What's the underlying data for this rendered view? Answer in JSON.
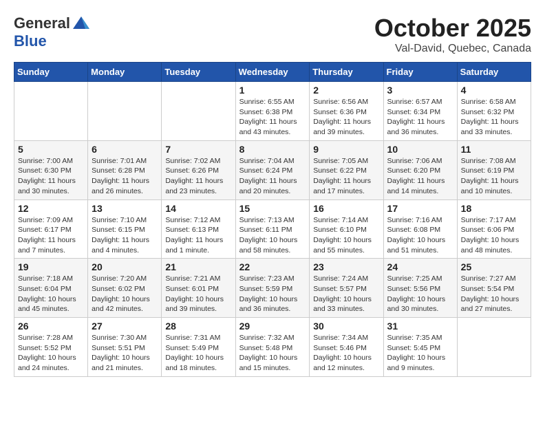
{
  "header": {
    "logo_line1": "General",
    "logo_line2": "Blue",
    "month": "October 2025",
    "location": "Val-David, Quebec, Canada"
  },
  "days_of_week": [
    "Sunday",
    "Monday",
    "Tuesday",
    "Wednesday",
    "Thursday",
    "Friday",
    "Saturday"
  ],
  "weeks": [
    [
      {
        "day": "",
        "info": ""
      },
      {
        "day": "",
        "info": ""
      },
      {
        "day": "",
        "info": ""
      },
      {
        "day": "1",
        "info": "Sunrise: 6:55 AM\nSunset: 6:38 PM\nDaylight: 11 hours and 43 minutes."
      },
      {
        "day": "2",
        "info": "Sunrise: 6:56 AM\nSunset: 6:36 PM\nDaylight: 11 hours and 39 minutes."
      },
      {
        "day": "3",
        "info": "Sunrise: 6:57 AM\nSunset: 6:34 PM\nDaylight: 11 hours and 36 minutes."
      },
      {
        "day": "4",
        "info": "Sunrise: 6:58 AM\nSunset: 6:32 PM\nDaylight: 11 hours and 33 minutes."
      }
    ],
    [
      {
        "day": "5",
        "info": "Sunrise: 7:00 AM\nSunset: 6:30 PM\nDaylight: 11 hours and 30 minutes."
      },
      {
        "day": "6",
        "info": "Sunrise: 7:01 AM\nSunset: 6:28 PM\nDaylight: 11 hours and 26 minutes."
      },
      {
        "day": "7",
        "info": "Sunrise: 7:02 AM\nSunset: 6:26 PM\nDaylight: 11 hours and 23 minutes."
      },
      {
        "day": "8",
        "info": "Sunrise: 7:04 AM\nSunset: 6:24 PM\nDaylight: 11 hours and 20 minutes."
      },
      {
        "day": "9",
        "info": "Sunrise: 7:05 AM\nSunset: 6:22 PM\nDaylight: 11 hours and 17 minutes."
      },
      {
        "day": "10",
        "info": "Sunrise: 7:06 AM\nSunset: 6:20 PM\nDaylight: 11 hours and 14 minutes."
      },
      {
        "day": "11",
        "info": "Sunrise: 7:08 AM\nSunset: 6:19 PM\nDaylight: 11 hours and 10 minutes."
      }
    ],
    [
      {
        "day": "12",
        "info": "Sunrise: 7:09 AM\nSunset: 6:17 PM\nDaylight: 11 hours and 7 minutes."
      },
      {
        "day": "13",
        "info": "Sunrise: 7:10 AM\nSunset: 6:15 PM\nDaylight: 11 hours and 4 minutes."
      },
      {
        "day": "14",
        "info": "Sunrise: 7:12 AM\nSunset: 6:13 PM\nDaylight: 11 hours and 1 minute."
      },
      {
        "day": "15",
        "info": "Sunrise: 7:13 AM\nSunset: 6:11 PM\nDaylight: 10 hours and 58 minutes."
      },
      {
        "day": "16",
        "info": "Sunrise: 7:14 AM\nSunset: 6:10 PM\nDaylight: 10 hours and 55 minutes."
      },
      {
        "day": "17",
        "info": "Sunrise: 7:16 AM\nSunset: 6:08 PM\nDaylight: 10 hours and 51 minutes."
      },
      {
        "day": "18",
        "info": "Sunrise: 7:17 AM\nSunset: 6:06 PM\nDaylight: 10 hours and 48 minutes."
      }
    ],
    [
      {
        "day": "19",
        "info": "Sunrise: 7:18 AM\nSunset: 6:04 PM\nDaylight: 10 hours and 45 minutes."
      },
      {
        "day": "20",
        "info": "Sunrise: 7:20 AM\nSunset: 6:02 PM\nDaylight: 10 hours and 42 minutes."
      },
      {
        "day": "21",
        "info": "Sunrise: 7:21 AM\nSunset: 6:01 PM\nDaylight: 10 hours and 39 minutes."
      },
      {
        "day": "22",
        "info": "Sunrise: 7:23 AM\nSunset: 5:59 PM\nDaylight: 10 hours and 36 minutes."
      },
      {
        "day": "23",
        "info": "Sunrise: 7:24 AM\nSunset: 5:57 PM\nDaylight: 10 hours and 33 minutes."
      },
      {
        "day": "24",
        "info": "Sunrise: 7:25 AM\nSunset: 5:56 PM\nDaylight: 10 hours and 30 minutes."
      },
      {
        "day": "25",
        "info": "Sunrise: 7:27 AM\nSunset: 5:54 PM\nDaylight: 10 hours and 27 minutes."
      }
    ],
    [
      {
        "day": "26",
        "info": "Sunrise: 7:28 AM\nSunset: 5:52 PM\nDaylight: 10 hours and 24 minutes."
      },
      {
        "day": "27",
        "info": "Sunrise: 7:30 AM\nSunset: 5:51 PM\nDaylight: 10 hours and 21 minutes."
      },
      {
        "day": "28",
        "info": "Sunrise: 7:31 AM\nSunset: 5:49 PM\nDaylight: 10 hours and 18 minutes."
      },
      {
        "day": "29",
        "info": "Sunrise: 7:32 AM\nSunset: 5:48 PM\nDaylight: 10 hours and 15 minutes."
      },
      {
        "day": "30",
        "info": "Sunrise: 7:34 AM\nSunset: 5:46 PM\nDaylight: 10 hours and 12 minutes."
      },
      {
        "day": "31",
        "info": "Sunrise: 7:35 AM\nSunset: 5:45 PM\nDaylight: 10 hours and 9 minutes."
      },
      {
        "day": "",
        "info": ""
      }
    ]
  ]
}
